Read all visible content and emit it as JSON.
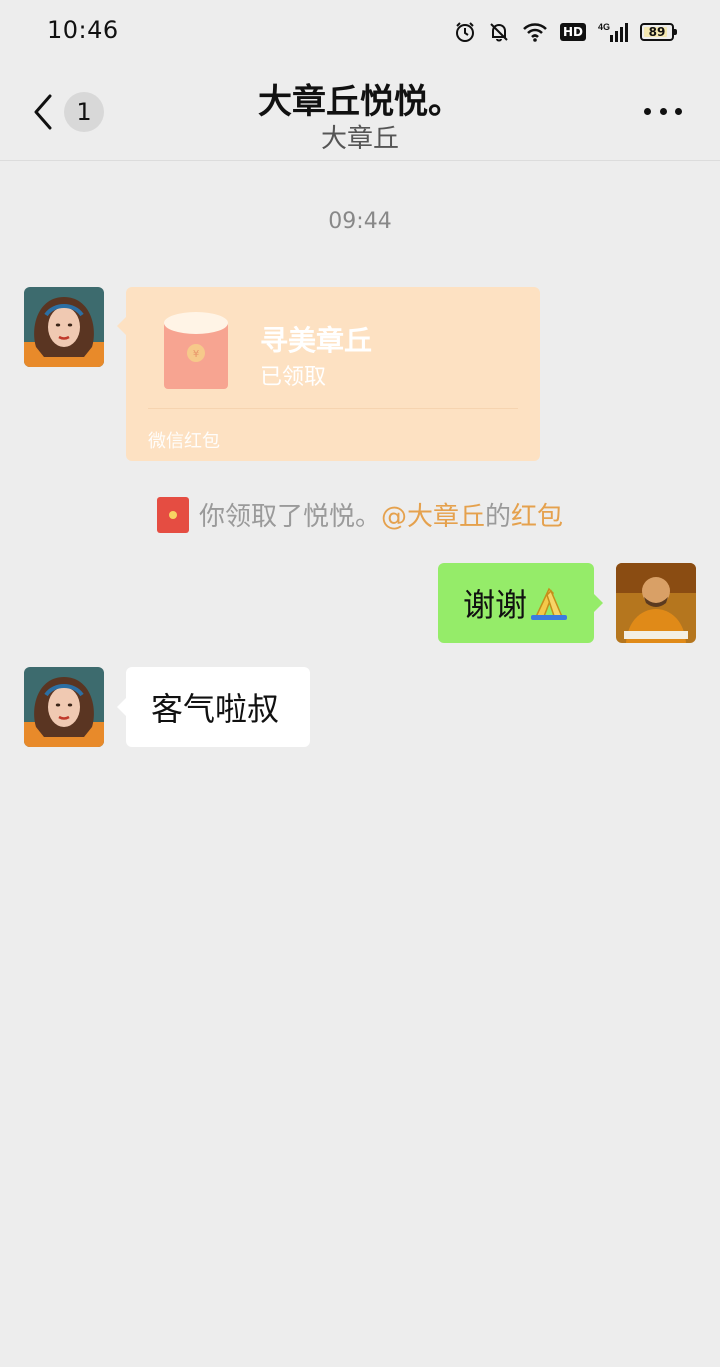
{
  "status_bar": {
    "time": "10:46",
    "network": "4G",
    "hd_label": "HD",
    "battery": "89",
    "battery_level": 0.89,
    "icons": [
      "alarm-icon",
      "mute-bell-icon",
      "wifi-icon",
      "hd-icon",
      "signal-icon",
      "battery-icon"
    ]
  },
  "header": {
    "title": "大章丘悦悦。",
    "subtitle": "大章丘",
    "unread_count": "1",
    "back_icon": "chevron-left-icon",
    "more_icon": "more-dots-icon"
  },
  "chat": {
    "timestamp": "09:44",
    "red_packet": {
      "title": "寻美章丘",
      "status": "已领取",
      "footer": "微信红包",
      "color": "#fde1c2"
    },
    "system_note": {
      "prefix": "你领取了悦悦。",
      "mention": "@大章丘",
      "middle": "的",
      "link": "红包"
    },
    "my_message": {
      "text": "谢谢",
      "emoji": "pray-emoji-icon",
      "bubble_color": "#95ec69"
    },
    "their_message": {
      "text": "客气啦叔"
    }
  },
  "colors": {
    "background": "#ededed",
    "accent_orange": "#e5a14d",
    "my_bubble": "#95ec69"
  }
}
